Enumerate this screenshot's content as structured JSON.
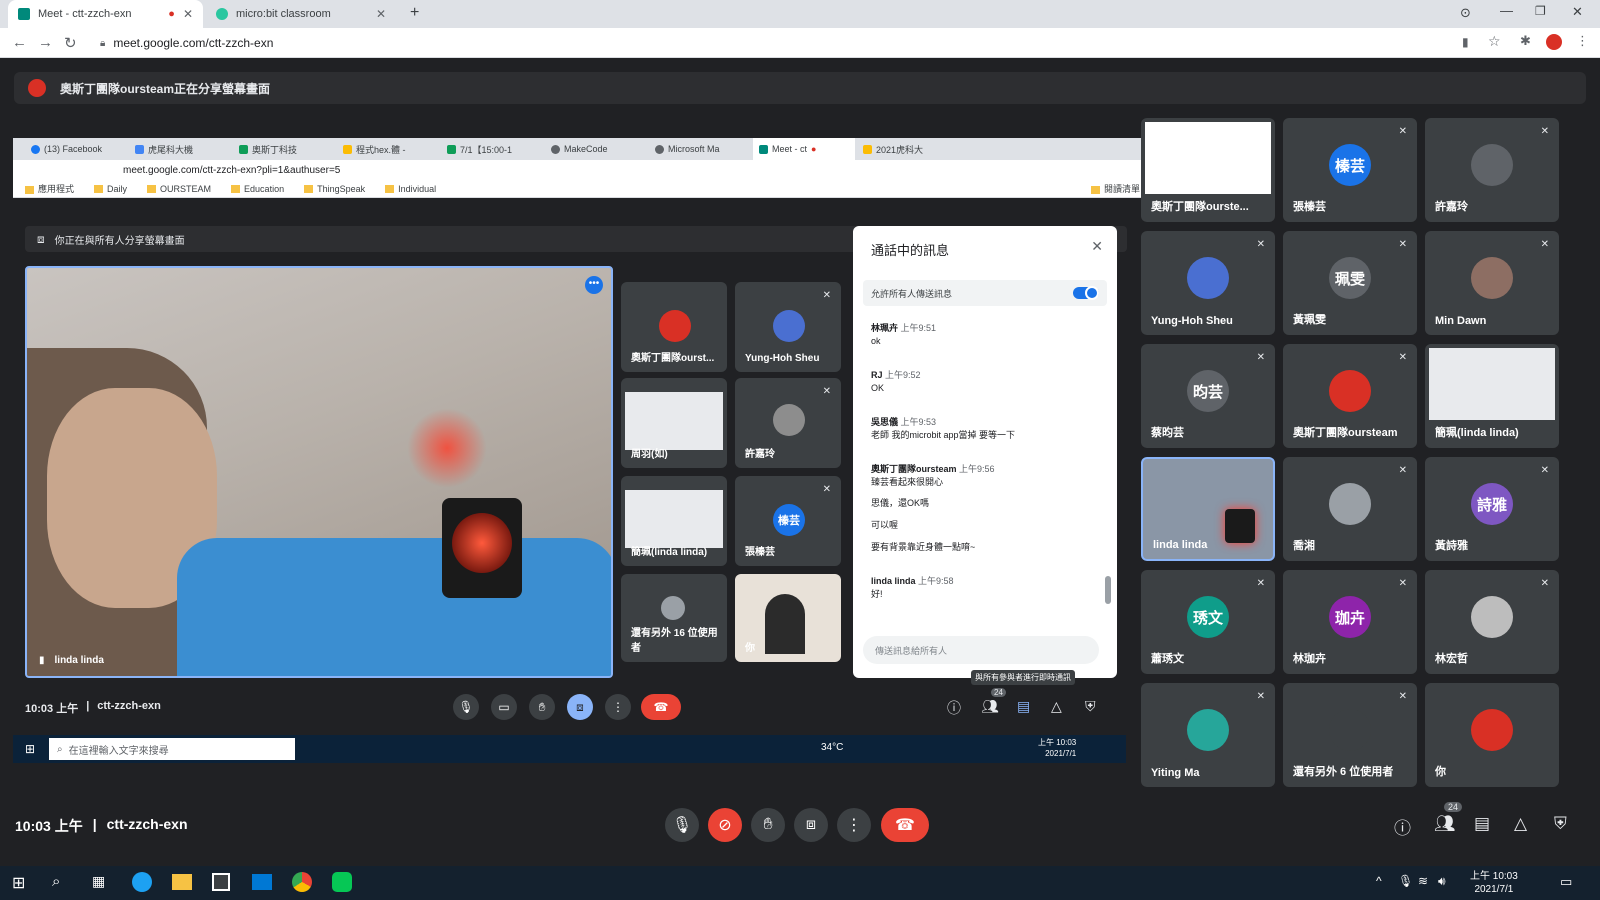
{
  "browser": {
    "tabs": [
      {
        "label": "Meet - ctt-zzch-exn",
        "active": true
      },
      {
        "label": "micro:bit classroom",
        "active": false
      }
    ],
    "url": "meet.google.com/ctt-zzch-exn"
  },
  "share_banner": "奧斯丁團隊oursteam正在分享螢幕畫面",
  "inner": {
    "tabs": [
      "(13) Facebook",
      "虎尾科大機",
      "奧斯丁科技",
      "程式hex.體 -",
      "7/1【15:00-1",
      "MakeCode",
      "Microsoft Ma",
      "Meet - ct",
      "2021虎科大"
    ],
    "url": "meet.google.com/ctt-zzch-exn?pli=1&authuser=5",
    "bookmarks": [
      "應用程式",
      "Daily",
      "OURSTEAM",
      "Education",
      "ThingSpeak",
      "Individual"
    ],
    "reading_list": "閱讀清單",
    "present_text": "你正在與所有人分享螢幕畫面",
    "main_name": "linda linda",
    "tiles": [
      {
        "name": "奧斯丁團隊ourst...",
        "initial": ""
      },
      {
        "name": "Yung-Hoh Sheu",
        "initial": ""
      },
      {
        "name": "周羽(如)",
        "initial": ""
      },
      {
        "name": "許嘉玲",
        "initial": ""
      },
      {
        "name": "簡珮(linda linda)",
        "initial": ""
      },
      {
        "name": "張榛芸",
        "initial": "榛芸"
      },
      {
        "name": "還有另外 16 位使用者",
        "initial": ""
      },
      {
        "name": "你",
        "initial": ""
      }
    ],
    "chat": {
      "title": "通話中的訊息",
      "toggle_label": "允許所有人傳送訊息",
      "messages": [
        {
          "sender": "林珮卉",
          "time": "上午9:51",
          "text": "ok"
        },
        {
          "sender": "RJ",
          "time": "上午9:52",
          "text": "OK"
        },
        {
          "sender": "吳思儀",
          "time": "上午9:53",
          "text": "老師 我的microbit app當掉 要等一下"
        },
        {
          "sender": "奧斯丁團隊oursteam",
          "time": "上午9:56",
          "text": "臻芸看起來很開心"
        },
        {
          "sender": "",
          "time": "",
          "text": "思儀，還OK嗎"
        },
        {
          "sender": "",
          "time": "",
          "text": "可以喔"
        },
        {
          "sender": "",
          "time": "",
          "text": "要有背景靠近身體一點唷~"
        },
        {
          "sender": "linda linda",
          "time": "上午9:58",
          "text": "好!"
        }
      ],
      "placeholder": "傳送訊息給所有人",
      "tooltip": "與所有參與者進行即時通訊"
    },
    "time": "10:03 上午",
    "code": "ctt-zzch-exn",
    "people_count": "24",
    "search_placeholder": "在這裡輸入文字來搜尋",
    "weather": "34°C",
    "clock_time": "上午 10:03",
    "clock_date": "2021/7/1"
  },
  "grid": [
    {
      "name": "奧斯丁團隊ourste...",
      "initial": "",
      "color": "#3c4043"
    },
    {
      "name": "張榛芸",
      "initial": "榛芸",
      "color": "#1a73e8"
    },
    {
      "name": "許嘉玲",
      "initial": "",
      "color": "#5f6368"
    },
    {
      "name": "Yung-Hoh Sheu",
      "initial": "",
      "color": "#4a6fd1"
    },
    {
      "name": "黃珮雯",
      "initial": "珮雯",
      "color": "#5f6368"
    },
    {
      "name": "Min Dawn",
      "initial": "",
      "color": "#8d6e63"
    },
    {
      "name": "蔡昀芸",
      "initial": "昀芸",
      "color": "#5f6368"
    },
    {
      "name": "奧斯丁團隊oursteam",
      "initial": "",
      "color": "#d93025"
    },
    {
      "name": "簡珮(linda linda)",
      "initial": "",
      "color": "#3c4043"
    },
    {
      "name": "linda linda",
      "initial": "",
      "color": "#3c4043"
    },
    {
      "name": "喬湘",
      "initial": "",
      "color": "#9aa0a6"
    },
    {
      "name": "黃詩雅",
      "initial": "詩雅",
      "color": "#7e57c2"
    },
    {
      "name": "蕭琇文",
      "initial": "琇文",
      "color": "#0f9d8a"
    },
    {
      "name": "林珈卉",
      "initial": "珈卉",
      "color": "#8e24aa"
    },
    {
      "name": "林宏哲",
      "initial": "",
      "color": "#bdbdbd"
    },
    {
      "name": "Yiting Ma",
      "initial": "",
      "color": "#26a69a"
    },
    {
      "name": "還有另外 6 位使用者",
      "initial": "",
      "color": "#3c4043"
    },
    {
      "name": "你",
      "initial": "",
      "color": "#d93025"
    }
  ],
  "bottom": {
    "time": "10:03 上午",
    "code": "ctt-zzch-exn",
    "people_count": "24"
  },
  "taskbar": {
    "time": "上午 10:03",
    "date": "2021/7/1"
  }
}
